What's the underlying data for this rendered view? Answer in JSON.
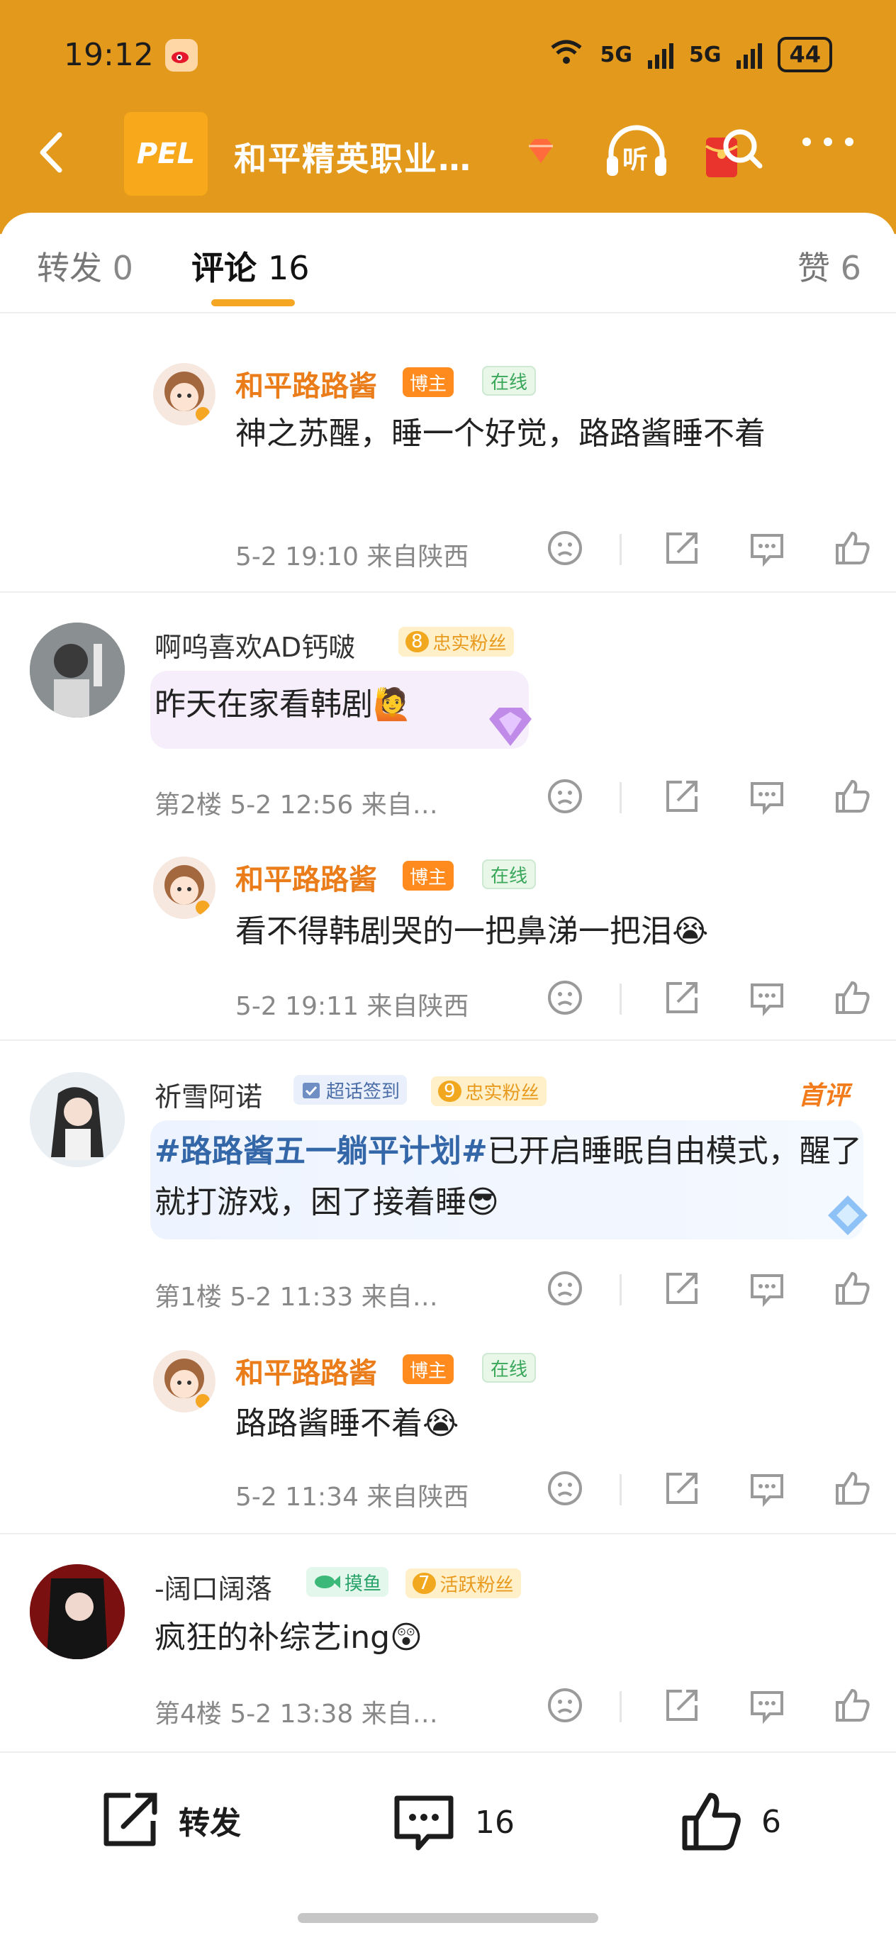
{
  "status_bar": {
    "time": "19:12",
    "net1": "5G",
    "net2": "5G",
    "battery": "44"
  },
  "nav": {
    "logo_text": "PEL",
    "title": "和平精英职业…",
    "listen_label": "听"
  },
  "tabs": [
    {
      "label": "转发",
      "count": "0"
    },
    {
      "label": "评论",
      "count": "16"
    },
    {
      "label": "赞",
      "count": "6"
    }
  ],
  "comments": [
    {
      "kind": "reply",
      "user": "和平路路酱",
      "host_badge": "博主",
      "online_badge": "在线",
      "text": "神之苏醒，睡一个好觉，路路酱睡不着",
      "meta": "5-2 19:10 来自陕西"
    },
    {
      "kind": "top",
      "user": "啊呜喜欢AD钙啵",
      "fan_level": "8",
      "fan_badge": "忠实粉丝",
      "text": "昨天在家看韩剧🙋",
      "meta": "第2楼 5-2 12:56 来自…"
    },
    {
      "kind": "reply",
      "user": "和平路路酱",
      "host_badge": "博主",
      "online_badge": "在线",
      "text": "看不得韩剧哭的一把鼻涕一把泪😭",
      "meta": "5-2 19:11 来自陕西"
    },
    {
      "kind": "top",
      "user": "祈雪阿诺",
      "sign_badge": "超话签到",
      "fan_level": "9",
      "fan_badge": "忠实粉丝",
      "first_tag": "首评",
      "hashtag": "#路路酱五一躺平计划#",
      "text": "已开启睡眠自由模式，醒了就打游戏，困了接着睡😎",
      "meta": "第1楼 5-2 11:33 来自…"
    },
    {
      "kind": "reply",
      "user": "和平路路酱",
      "host_badge": "博主",
      "online_badge": "在线",
      "text": "路路酱睡不着😭",
      "meta": "5-2 11:34 来自陕西"
    },
    {
      "kind": "top",
      "user": "-阔口阔落",
      "fish_badge": "摸鱼",
      "fan_level": "7",
      "fan_badge": "活跃粉丝",
      "text": "疯狂的补综艺ing😲",
      "meta": "第4楼 5-2 13:38 来自…"
    }
  ],
  "bottom_bar": {
    "repost_label": "转发",
    "comment_count": "16",
    "like_count": "6"
  },
  "colors": {
    "header": "#e39a1c",
    "accent": "#f5a623",
    "orange_name": "#ea7c19",
    "hashtag": "#3467a8"
  }
}
